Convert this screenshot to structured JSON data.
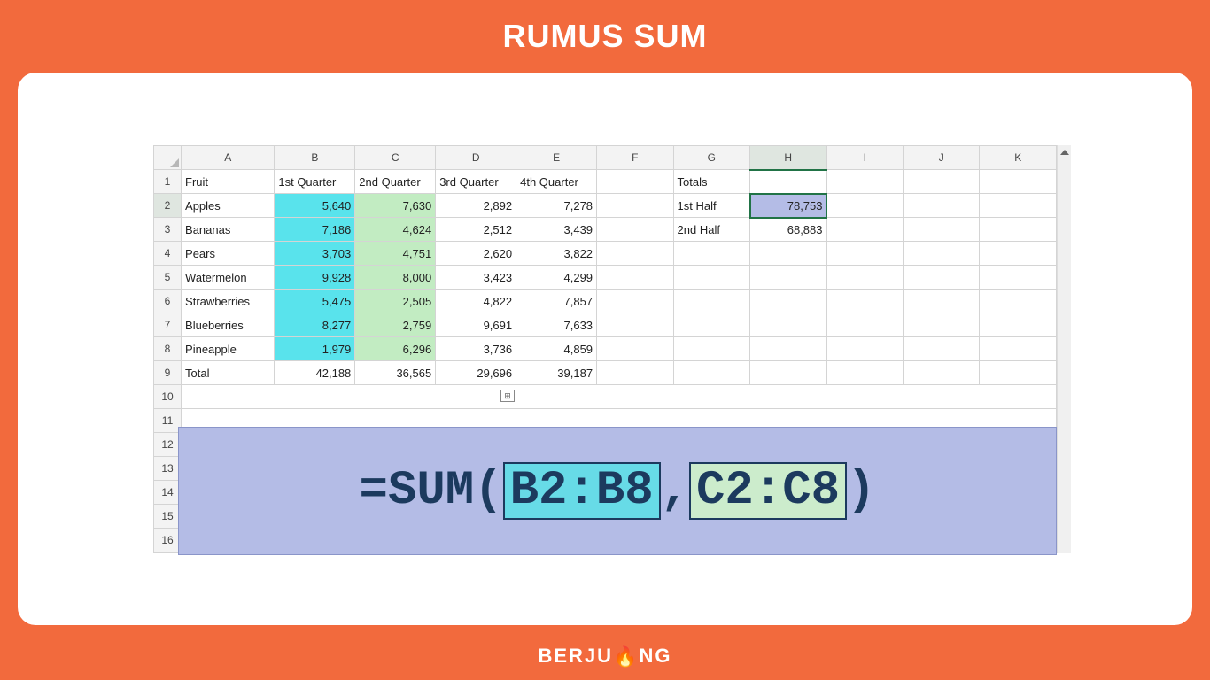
{
  "page_title": "RUMUS SUM",
  "footer_brand_pre": "BERJU",
  "footer_brand_post": "NG",
  "columns": [
    "A",
    "B",
    "C",
    "D",
    "E",
    "F",
    "G",
    "H",
    "I",
    "J",
    "K"
  ],
  "headers_row": {
    "r": "1",
    "A": "Fruit",
    "B": "1st Quarter",
    "C": "2nd Quarter",
    "D": "3rd Quarter",
    "E": "4th Quarter",
    "G": "Totals"
  },
  "rows": [
    {
      "r": "2",
      "A": "Apples",
      "B": "5,640",
      "C": "7,630",
      "D": "2,892",
      "E": "7,278",
      "G": "1st Half",
      "H": "78,753"
    },
    {
      "r": "3",
      "A": "Bananas",
      "B": "7,186",
      "C": "4,624",
      "D": "2,512",
      "E": "3,439",
      "G": "2nd Half",
      "H": "68,883"
    },
    {
      "r": "4",
      "A": "Pears",
      "B": "3,703",
      "C": "4,751",
      "D": "2,620",
      "E": "3,822"
    },
    {
      "r": "5",
      "A": "Watermelon",
      "B": "9,928",
      "C": "8,000",
      "D": "3,423",
      "E": "4,299"
    },
    {
      "r": "6",
      "A": "Strawberries",
      "B": "5,475",
      "C": "2,505",
      "D": "4,822",
      "E": "7,857"
    },
    {
      "r": "7",
      "A": "Blueberries",
      "B": "8,277",
      "C": "2,759",
      "D": "9,691",
      "E": "7,633"
    },
    {
      "r": "8",
      "A": "Pineapple",
      "B": "1,979",
      "C": "6,296",
      "D": "3,736",
      "E": "4,859"
    },
    {
      "r": "9",
      "A": "Total",
      "B": "42,188",
      "C": "36,565",
      "D": "29,696",
      "E": "39,187"
    },
    {
      "r": "10"
    },
    {
      "r": "11"
    },
    {
      "r": "12"
    },
    {
      "r": "13"
    },
    {
      "r": "14"
    },
    {
      "r": "15"
    },
    {
      "r": "16"
    }
  ],
  "formula": {
    "prefix": "=SUM(",
    "range1": "B2:B8",
    "comma": ",",
    "range2": "C2:C8",
    "suffix": ")"
  },
  "chart_data": {
    "type": "table",
    "title": "Fruit quarterly sales with SUM formula example",
    "columns": [
      "Fruit",
      "1st Quarter",
      "2nd Quarter",
      "3rd Quarter",
      "4th Quarter"
    ],
    "rows": [
      [
        "Apples",
        5640,
        7630,
        2892,
        7278
      ],
      [
        "Bananas",
        7186,
        4624,
        2512,
        3439
      ],
      [
        "Pears",
        3703,
        4751,
        2620,
        3822
      ],
      [
        "Watermelon",
        9928,
        8000,
        3423,
        4299
      ],
      [
        "Strawberries",
        5475,
        2505,
        4822,
        7857
      ],
      [
        "Blueberries",
        8277,
        2759,
        9691,
        7633
      ],
      [
        "Pineapple",
        1979,
        6296,
        3736,
        4859
      ],
      [
        "Total",
        42188,
        36565,
        29696,
        39187
      ]
    ],
    "totals": {
      "1st Half": 78753,
      "2nd Half": 68883
    },
    "formula": "=SUM(B2:B8,C2:C8)"
  }
}
